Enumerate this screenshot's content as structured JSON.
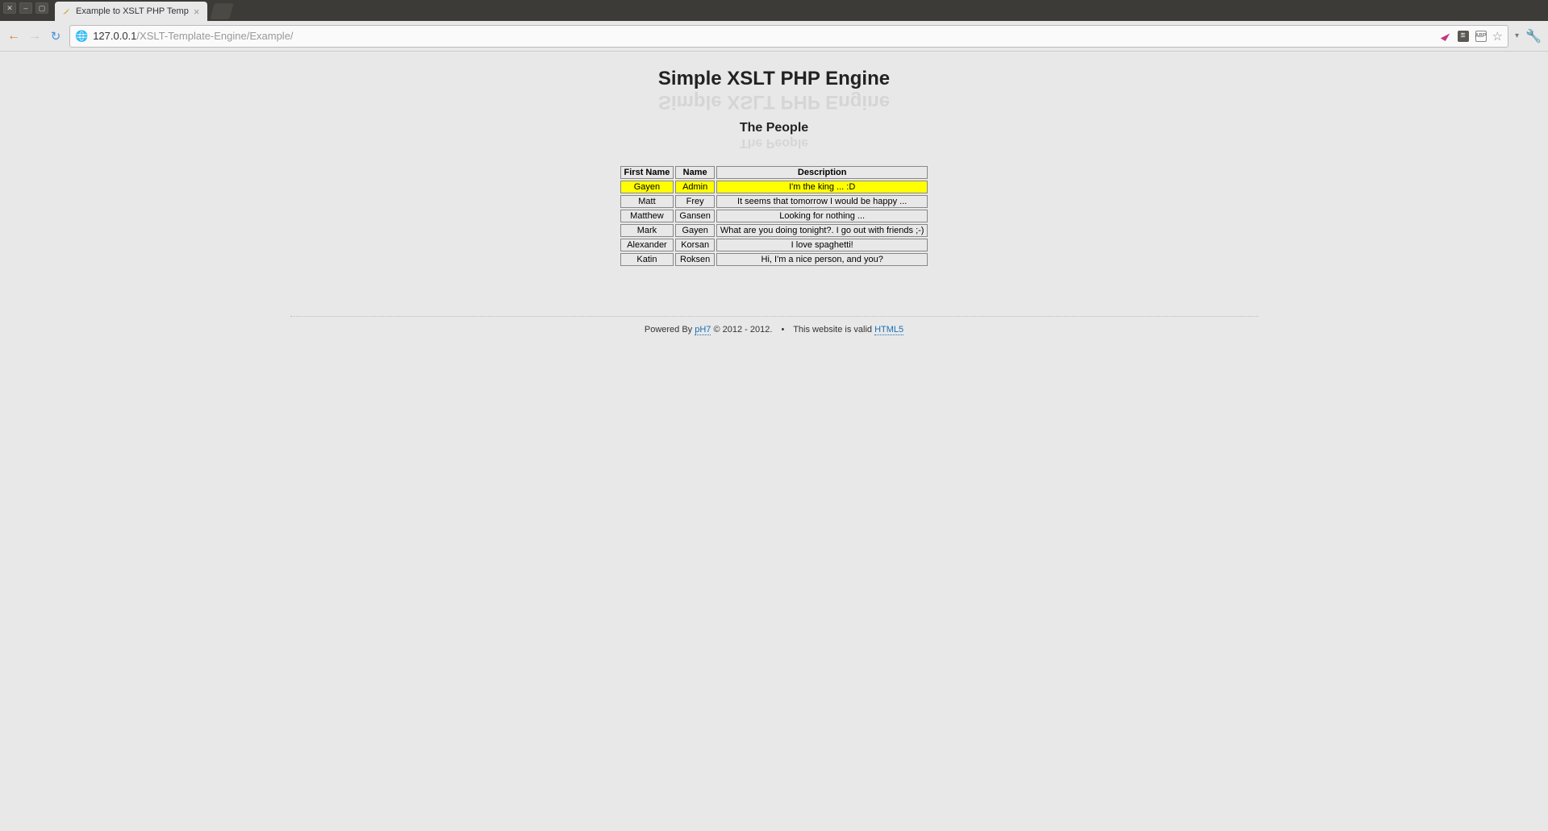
{
  "window": {
    "tab_title": "Example to XSLT PHP Temp"
  },
  "navigation": {
    "url_host": "127.0.0.1",
    "url_path": "/XSLT-Template-Engine/Example/"
  },
  "page": {
    "heading": "Simple XSLT PHP Engine",
    "subheading": "The People",
    "table": {
      "headers": [
        "First Name",
        "Name",
        "Description"
      ],
      "rows": [
        {
          "first_name": "Gayen",
          "name": "Admin",
          "description": "I'm the king ... :D",
          "highlight": true
        },
        {
          "first_name": "Matt",
          "name": "Frey",
          "description": "It seems that tomorrow I would be happy ...",
          "highlight": false
        },
        {
          "first_name": "Matthew",
          "name": "Gansen",
          "description": "Looking for nothing ...",
          "highlight": false
        },
        {
          "first_name": "Mark",
          "name": "Gayen",
          "description": "What are you doing tonight?. I go out with friends ;-)",
          "highlight": false
        },
        {
          "first_name": "Alexander",
          "name": "Korsan",
          "description": "I love spaghetti!",
          "highlight": false
        },
        {
          "first_name": "Katin",
          "name": "Roksen",
          "description": "Hi, I'm a nice person, and you?",
          "highlight": false
        }
      ]
    },
    "footer": {
      "powered_by_prefix": "Powered By ",
      "powered_by_link": "pH7",
      "copyright": " © 2012 - 2012.",
      "bullet": "•",
      "valid_prefix": "This website is valid ",
      "valid_link": "HTML5"
    }
  }
}
